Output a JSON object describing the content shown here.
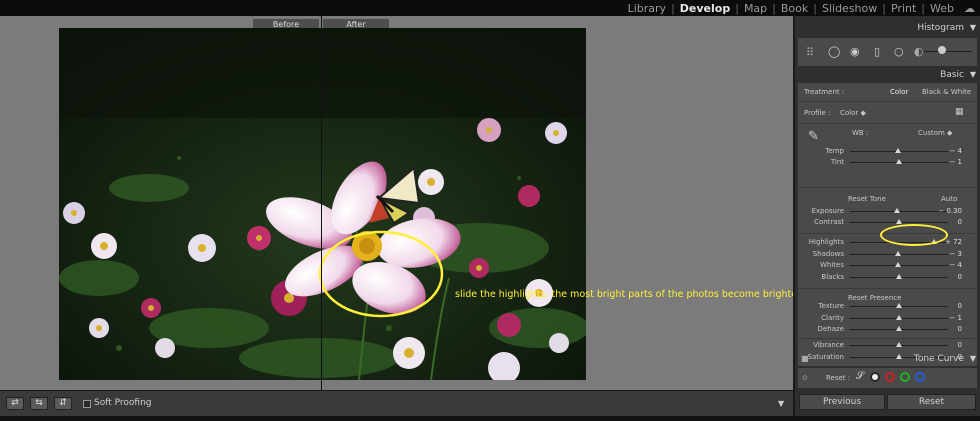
{
  "topbar": {
    "modules": [
      "Library",
      "Develop",
      "Map",
      "Book",
      "Slideshow",
      "Print",
      "Web"
    ],
    "active": "Develop"
  },
  "view": {
    "before_label": "Before",
    "after_label": "After"
  },
  "annotation": "slide the highlights, the most bright parts of the photos become brighter.",
  "toolbar": {
    "soft_proofing_label": "Soft Proofing",
    "soft_proofing_checked": false
  },
  "panel": {
    "histogram_title": "Histogram",
    "basic_title": "Basic",
    "treatment_label": "Treatment :",
    "treatment_color": "Color",
    "treatment_bw": "Black & White",
    "profile_label": "Profile :",
    "profile_value": "Color",
    "wb_label": "WB :",
    "wb_value": "Custom",
    "sliders_wb": [
      {
        "label": "Temp",
        "value": "− 4",
        "level": 0.49
      },
      {
        "label": "Tint",
        "value": "− 1",
        "level": 0.5
      }
    ],
    "tone_title": "Reset Tone",
    "tone_auto": "Auto",
    "sliders_tone": [
      {
        "label": "Exposure",
        "value": "− 0.30",
        "level": 0.48
      },
      {
        "label": "Contrast",
        "value": "0",
        "level": 0.5
      }
    ],
    "sliders_tone2": [
      {
        "label": "Highlights",
        "value": "+ 72",
        "level": 0.86
      },
      {
        "label": "Shadows",
        "value": "− 3",
        "level": 0.49
      },
      {
        "label": "Whites",
        "value": "− 4",
        "level": 0.49
      },
      {
        "label": "Blacks",
        "value": "0",
        "level": 0.5
      }
    ],
    "presence_title": "Reset Presence",
    "sliders_presence": [
      {
        "label": "Texture",
        "value": "0",
        "level": 0.5
      },
      {
        "label": "Clarity",
        "value": "− 1",
        "level": 0.5
      },
      {
        "label": "Dehaze",
        "value": "0",
        "level": 0.5
      }
    ],
    "sliders_presence2": [
      {
        "label": "Vibrance",
        "value": "0",
        "level": 0.5
      },
      {
        "label": "Saturation",
        "value": "0",
        "level": 0.5
      }
    ],
    "tone_curve_title": "Tone Curve",
    "curve_reset_label": "Reset :",
    "previous_label": "Previous",
    "reset_label": "Reset"
  }
}
